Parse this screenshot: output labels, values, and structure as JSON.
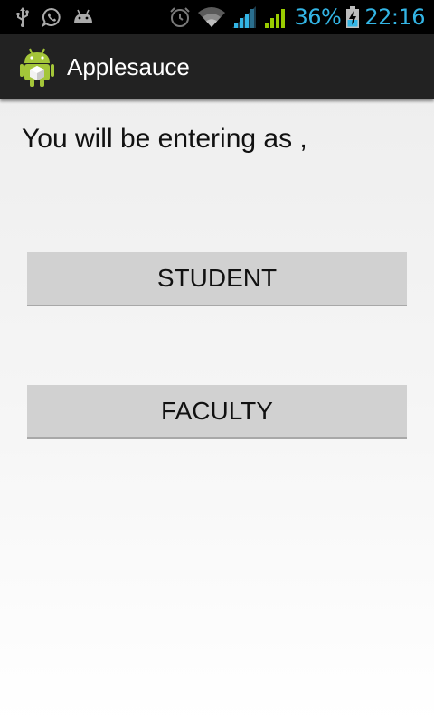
{
  "status_bar": {
    "left_icons": [
      "usb-icon",
      "whatsapp-icon",
      "android-debug-icon"
    ],
    "right_icons": [
      "alarm-icon",
      "wifi-icon",
      "signal-icon",
      "signal-icon"
    ],
    "battery_percent": "36%",
    "time": "22:16",
    "accent_color": "#33b5e5"
  },
  "action_bar": {
    "title": "Applesauce",
    "icon": "android-app-icon"
  },
  "main": {
    "prompt": "You will be entering as ,",
    "buttons": {
      "student": "STUDENT",
      "faculty": "FACULTY"
    }
  }
}
